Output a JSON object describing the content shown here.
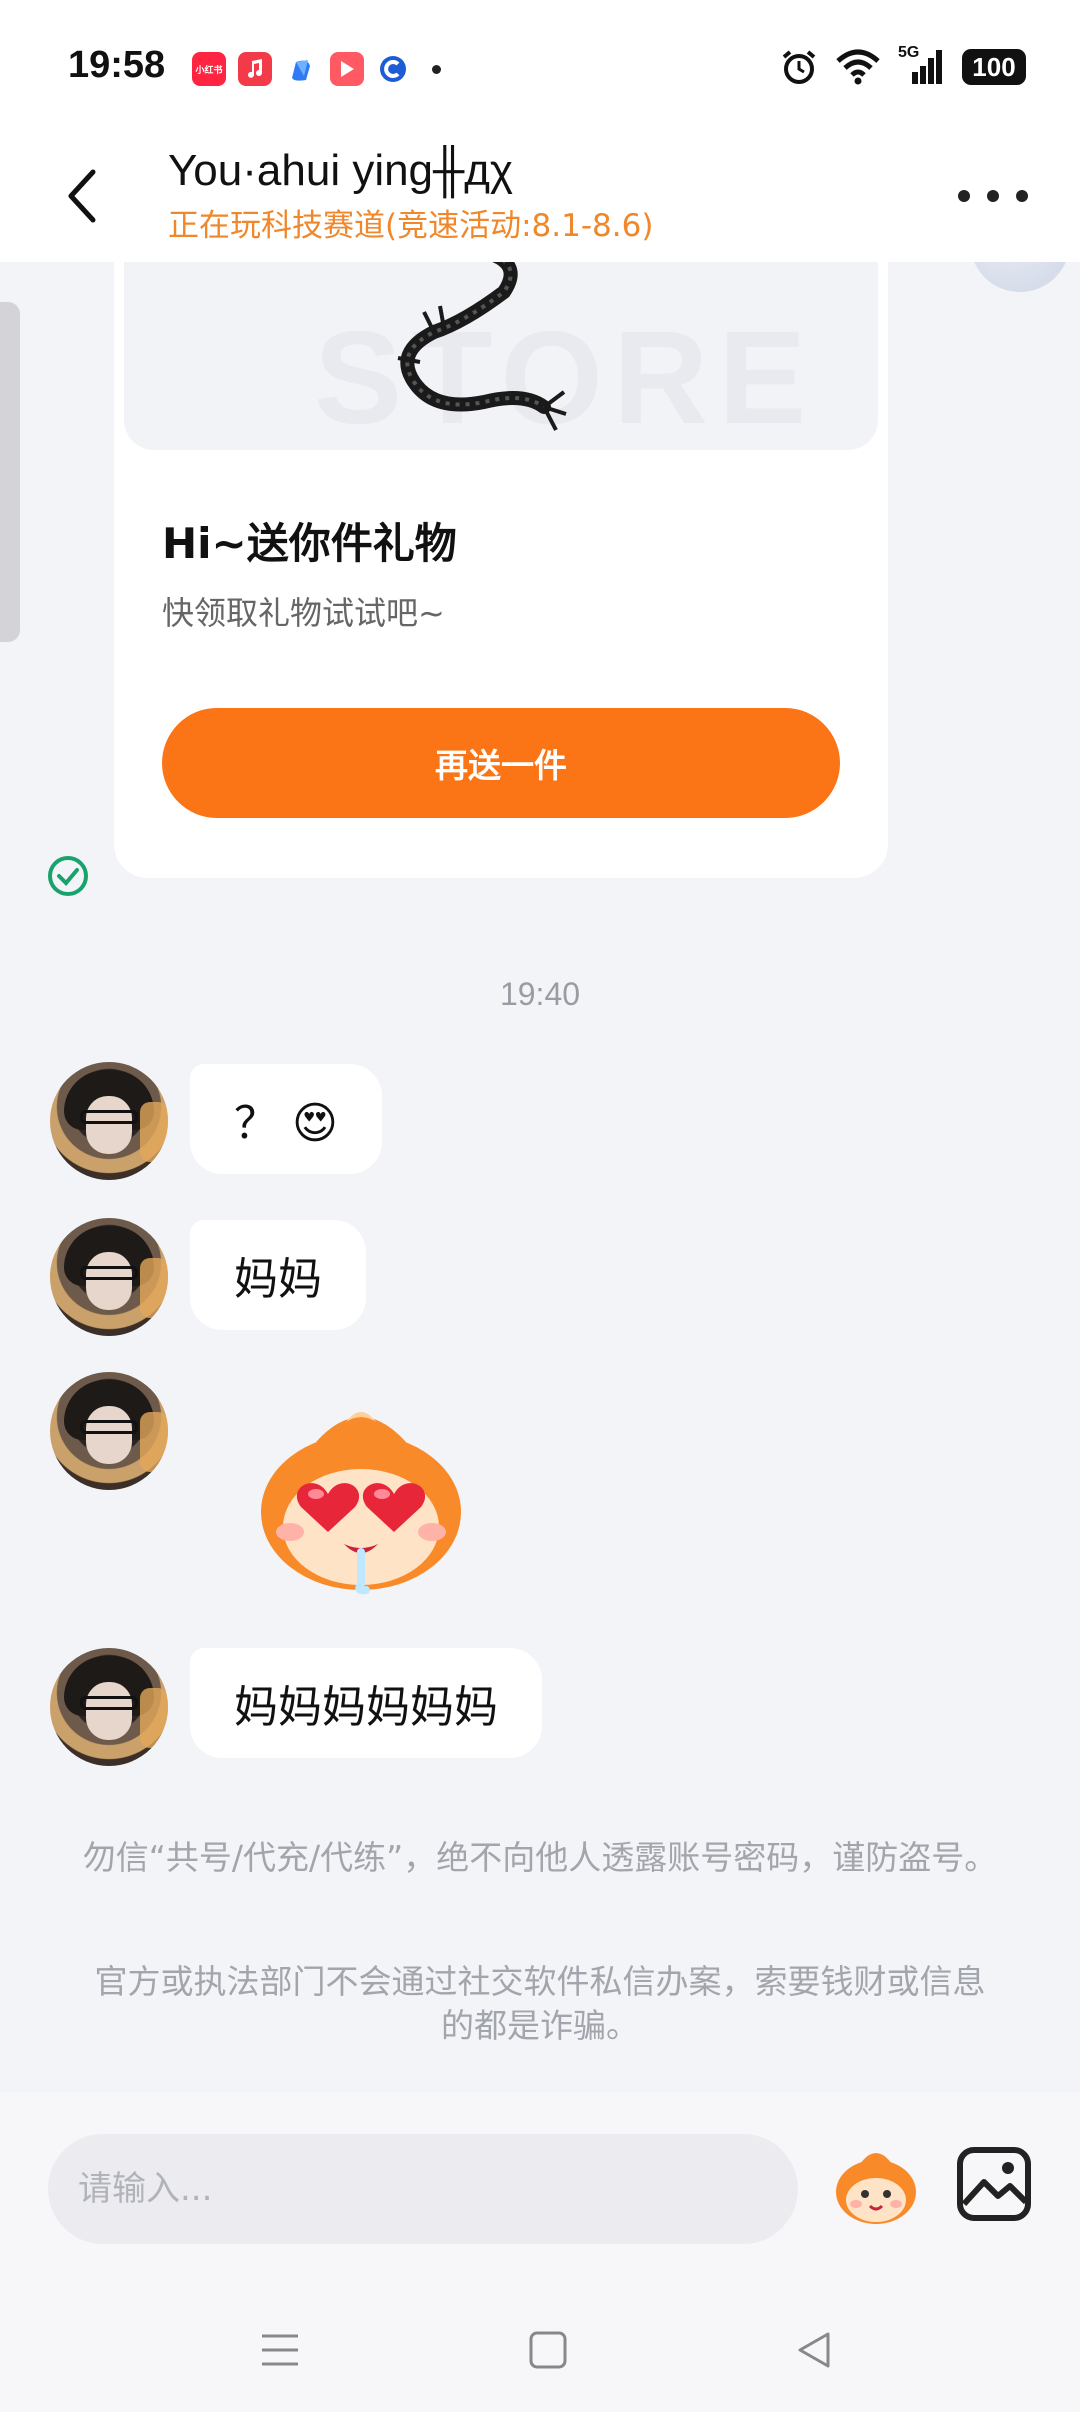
{
  "status_bar": {
    "time": "19:58",
    "app_icons": [
      {
        "name": "xiaohongshu-icon",
        "label": "小红书",
        "color": "#ff2442"
      },
      {
        "name": "music-icon",
        "label": "",
        "color": "#f23a48"
      },
      {
        "name": "browser-icon",
        "label": "",
        "color": "#2f7bf5"
      },
      {
        "name": "video-icon",
        "label": "",
        "color": "#ff5a63"
      },
      {
        "name": "app-c-icon",
        "label": "",
        "color": "#1e5cd6"
      }
    ],
    "network": "5G",
    "battery": "100"
  },
  "header": {
    "title": "You·ahui ying╫дχ",
    "subtitle": "正在玩科技赛道(竞速活动:8.1-8.6)"
  },
  "gift_card": {
    "title": "Hi~送你件礼物",
    "description": "快领取礼物试试吧~",
    "button_label": "再送一件"
  },
  "chat": {
    "timestamp": "19:40",
    "messages": [
      {
        "type": "text",
        "text": "？ 😍"
      },
      {
        "type": "text",
        "text": "妈妈"
      },
      {
        "type": "sticker",
        "sticker": "heart-eyes-mascot"
      },
      {
        "type": "text",
        "text": "妈妈妈妈妈妈"
      }
    ],
    "notices": [
      "勿信“共号/代充/代练”，绝不向他人透露账号密码，谨防盗号。",
      "官方或执法部门不会通过社交软件私信办案，索要钱财或信息的都是诈骗。"
    ]
  },
  "input": {
    "placeholder": "请输入..."
  },
  "colors": {
    "accent": "#fb7415",
    "subtitle": "#f0872a",
    "check": "#18a36c"
  }
}
